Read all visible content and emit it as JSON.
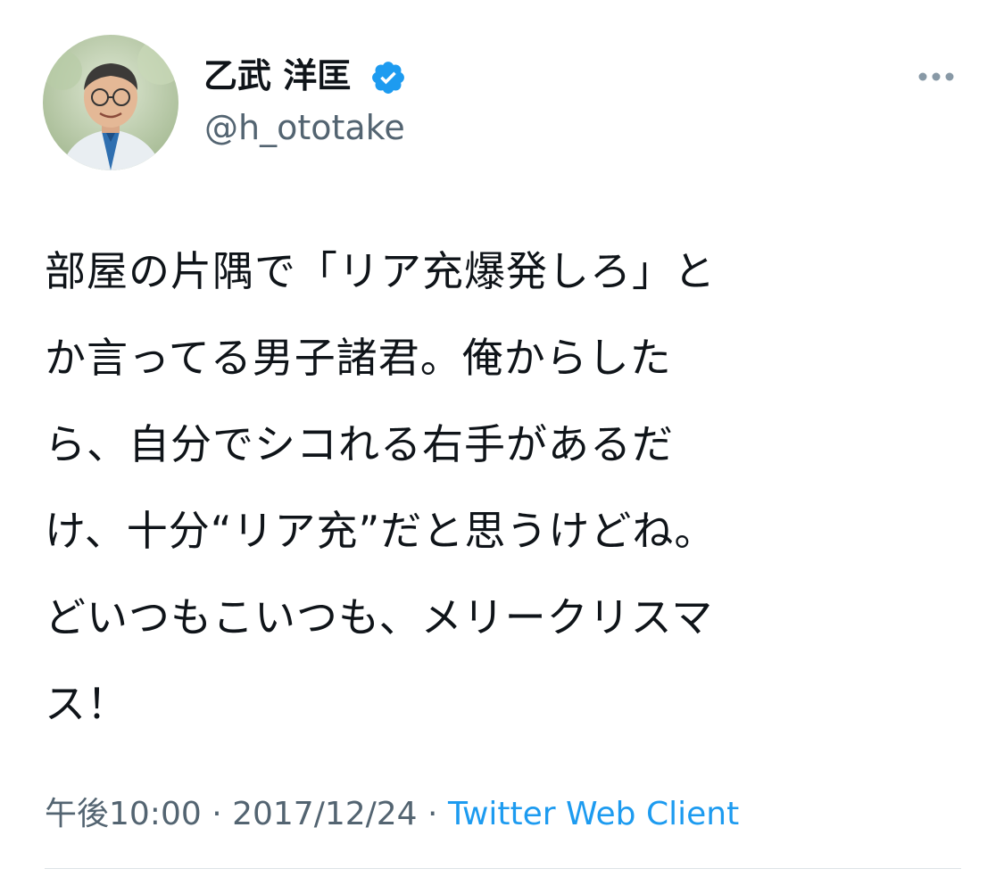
{
  "author": {
    "display_name": "乙武 洋匡",
    "handle": "@h_ototake",
    "verified_icon": "verified-badge-icon",
    "avatar_icon": "profile-photo"
  },
  "more_icon": "more-options-icon",
  "tweet": {
    "lines": [
      "部屋の片隅で「リア充爆発しろ」と",
      "か言ってる男子諸君。俺からした",
      "ら、自分でシコれる右手があるだ",
      "け、十分“リア充”だと思うけどね。",
      "どいつもこいつも、メリークリスマ",
      "ス！"
    ]
  },
  "meta": {
    "time": "午後10:00",
    "separator1": " · ",
    "date": "2017/12/24",
    "separator2": " · ",
    "source": "Twitter Web Client"
  },
  "colors": {
    "accent": "#1d9bf0",
    "text": "#0f1419",
    "secondary": "#536471"
  }
}
